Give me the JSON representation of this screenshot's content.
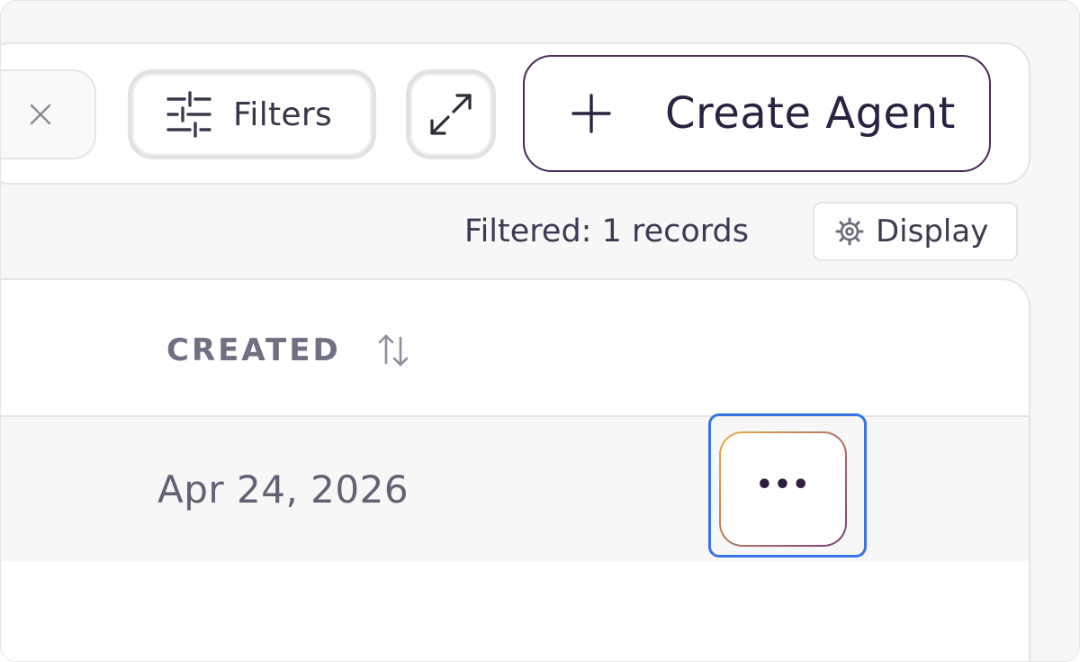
{
  "toolbar": {
    "filters_label": "Filters",
    "create_label": "Create Agent"
  },
  "status": {
    "filtered_text": "Filtered: 1 records",
    "display_label": "Display"
  },
  "table": {
    "columns": [
      "CREATED"
    ],
    "rows": [
      {
        "created": "Apr 24, 2026",
        "actions_label": "•••"
      }
    ]
  },
  "colors": {
    "accent": "#4a2858",
    "focus": "#3a74e0",
    "gradient_start": "#e7b04a",
    "gradient_end": "#7c3f7c"
  },
  "icons": {
    "clear": "close-icon",
    "filters": "sliders-icon",
    "expand": "expand-icon",
    "create": "plus-icon",
    "display": "gear-icon",
    "sort": "sort-icon",
    "actions": "more-horizontal-icon"
  }
}
